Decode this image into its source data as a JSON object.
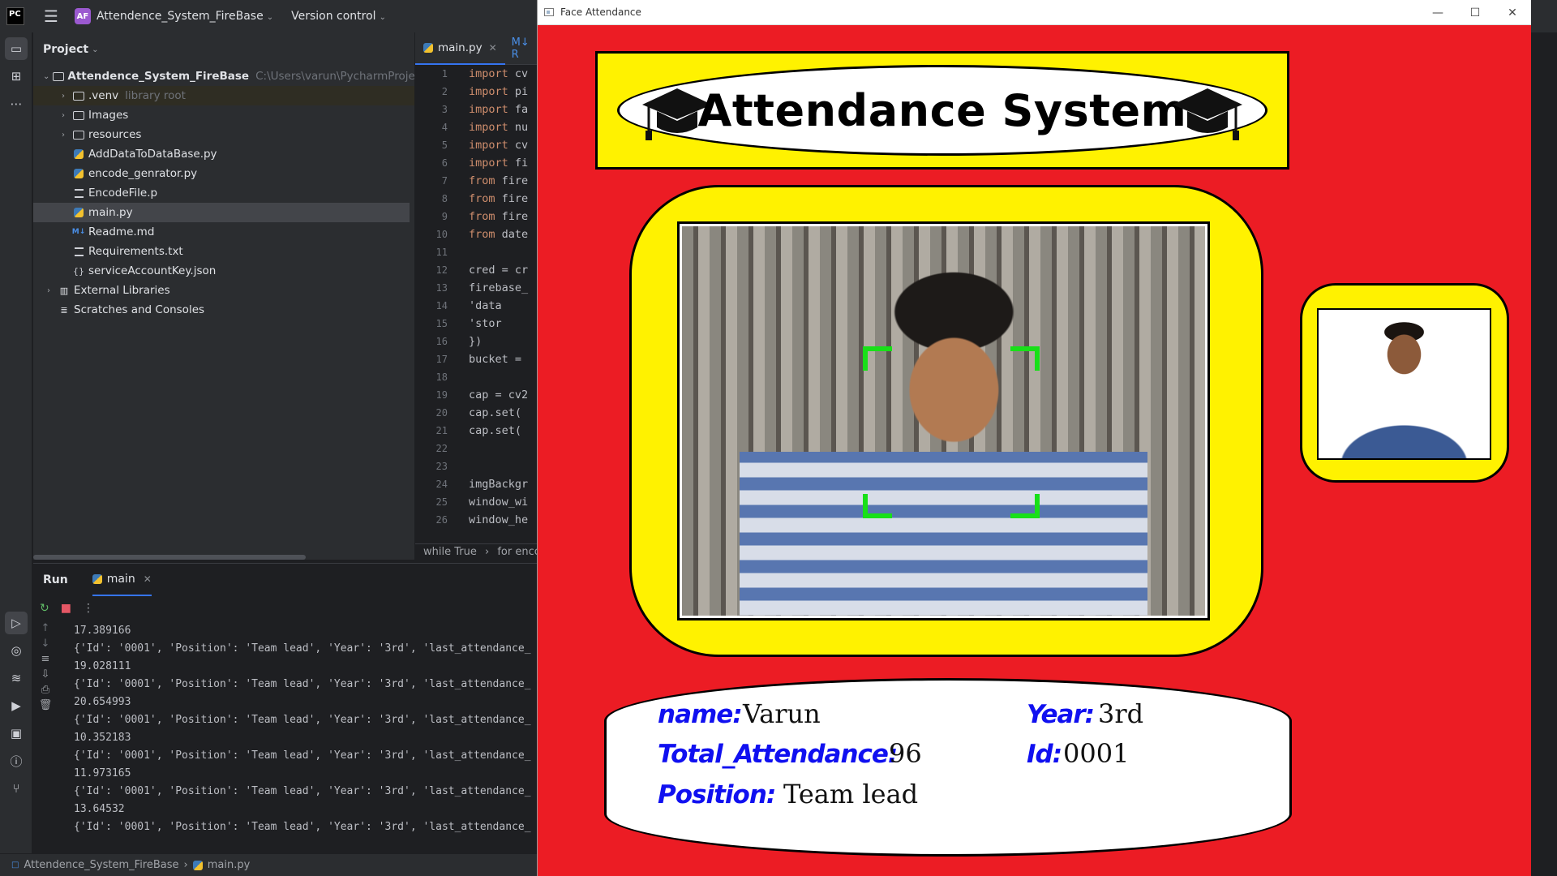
{
  "ide": {
    "logo": "PC",
    "project_badge": "AF",
    "project_name": "Attendence_System_FireBase",
    "version_control": "Version control",
    "project_panel_title": "Project",
    "tree": {
      "root": "Attendence_System_FireBase",
      "root_path": "C:\\Users\\varun\\PycharmProjects\\At",
      "venv": ".venv",
      "venv_hint": "library root",
      "images": "Images",
      "resources": "resources",
      "file1": "AddDataToDataBase.py",
      "file2": "encode_genrator.py",
      "file3": "EncodeFile.p",
      "file4": "main.py",
      "file5": "Readme.md",
      "file6": "Requirements.txt",
      "file7": "serviceAccountKey.json",
      "external": "External Libraries",
      "scratches": "Scratches and Consoles"
    },
    "editor_tab": "main.py",
    "editor_tab2": "M↓ R",
    "code_lines": [
      {
        "n": "1",
        "kw": "import",
        "rest": " cv"
      },
      {
        "n": "2",
        "kw": "import",
        "rest": " pi"
      },
      {
        "n": "3",
        "kw": "import",
        "rest": " fa"
      },
      {
        "n": "4",
        "kw": "import",
        "rest": " nu"
      },
      {
        "n": "5",
        "kw": "import",
        "rest": " cv"
      },
      {
        "n": "6",
        "kw": "import",
        "rest": " fi"
      },
      {
        "n": "7",
        "kw": "from",
        "rest": " fire"
      },
      {
        "n": "8",
        "kw": "from",
        "rest": " fire"
      },
      {
        "n": "9",
        "kw": "from",
        "rest": " fire"
      },
      {
        "n": "10",
        "kw": "from",
        "rest": " date"
      },
      {
        "n": "11",
        "kw": "",
        "rest": ""
      },
      {
        "n": "12",
        "kw": "",
        "rest": "cred = cr"
      },
      {
        "n": "13",
        "kw": "",
        "rest": "firebase_"
      },
      {
        "n": "14",
        "kw": "",
        "rest": "    'data"
      },
      {
        "n": "15",
        "kw": "",
        "rest": "    'stor"
      },
      {
        "n": "16",
        "kw": "",
        "rest": "})"
      },
      {
        "n": "17",
        "kw": "",
        "rest": "bucket = "
      },
      {
        "n": "18",
        "kw": "",
        "rest": ""
      },
      {
        "n": "19",
        "kw": "",
        "rest": "cap = cv2"
      },
      {
        "n": "20",
        "kw": "",
        "rest": "cap.set( "
      },
      {
        "n": "21",
        "kw": "",
        "rest": "cap.set( "
      },
      {
        "n": "22",
        "kw": "",
        "rest": ""
      },
      {
        "n": "23",
        "kw": "",
        "rest": ""
      },
      {
        "n": "24",
        "kw": "",
        "rest": "imgBackgr"
      },
      {
        "n": "25",
        "kw": "",
        "rest": "window_wi"
      },
      {
        "n": "26",
        "kw": "",
        "rest": "window_he"
      }
    ],
    "breadcrumb_a": "while True",
    "breadcrumb_b": "for enco",
    "run_title": "Run",
    "run_tab": "main",
    "console": [
      "17.389166",
      "{'Id': '0001', 'Position': 'Team lead', 'Year': '3rd', 'last_attendance_",
      "19.028111",
      "{'Id': '0001', 'Position': 'Team lead', 'Year': '3rd', 'last_attendance_",
      "20.654993",
      "{'Id': '0001', 'Position': 'Team lead', 'Year': '3rd', 'last_attendance_",
      "10.352183",
      "{'Id': '0001', 'Position': 'Team lead', 'Year': '3rd', 'last_attendance_",
      "11.973165",
      "{'Id': '0001', 'Position': 'Team lead', 'Year': '3rd', 'last_attendance_",
      "13.64532",
      "{'Id': '0001', 'Position': 'Team lead', 'Year': '3rd', 'last_attendance_"
    ],
    "status_project": "Attendence_System_FireBase",
    "status_file": "main.py"
  },
  "face_window": {
    "title": "Face Attendance",
    "header": "Attendance System",
    "labels": {
      "name": "name:",
      "total": "Total_Attendance:",
      "position": "Position:",
      "year": "Year:",
      "id": "Id:"
    },
    "values": {
      "name": "Varun",
      "total": "96",
      "position": "Team lead",
      "year": "3rd",
      "id": "0001"
    }
  }
}
